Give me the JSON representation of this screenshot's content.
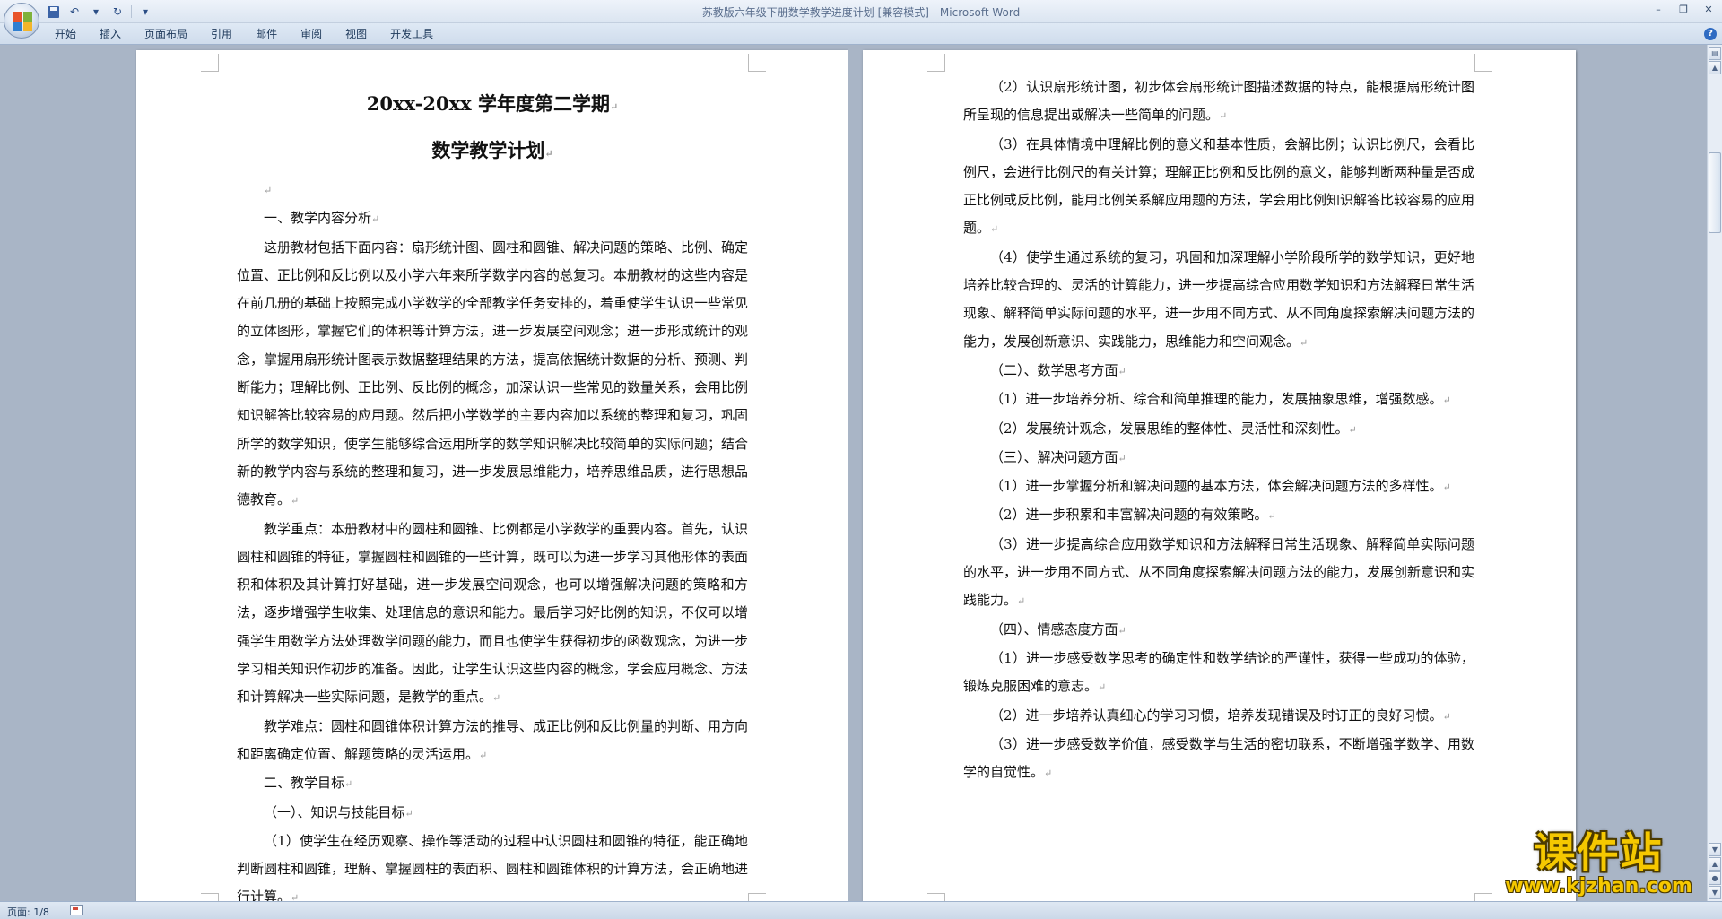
{
  "window": {
    "title": "苏教版六年级下册数学教学进度计划 [兼容模式] - Microsoft Word",
    "controls": [
      "–",
      "❐",
      "✕"
    ]
  },
  "ribbon": {
    "tabs": [
      "开始",
      "插入",
      "页面布局",
      "引用",
      "邮件",
      "审阅",
      "视图",
      "开发工具"
    ]
  },
  "qat": {
    "undo": "↶",
    "redo": "↻",
    "more": "▾"
  },
  "paragraph_mark": "↵",
  "left_page": {
    "title_line1": "20xx-20xx 学年度第二学期",
    "title_line2": "数学教学计划",
    "paragraphs": [
      "一、教学内容分析",
      "这册教材包括下面内容：扇形统计图、圆柱和圆锥、解决问题的策略、比例、确定位置、正比例和反比例以及小学六年来所学数学内容的总复习。本册教材的这些内容是在前几册的基础上按照完成小学数学的全部教学任务安排的，着重使学生认识一些常见的立体图形，掌握它们的体积等计算方法，进一步发展空间观念；进一步形成统计的观念，掌握用扇形统计图表示数据整理结果的方法，提高依据统计数据的分析、预测、判断能力；理解比例、正比例、反比例的概念，加深认识一些常见的数量关系，会用比例知识解答比较容易的应用题。然后把小学数学的主要内容加以系统的整理和复习，巩固所学的数学知识，使学生能够综合运用所学的数学知识解决比较简单的实际问题；结合新的教学内容与系统的整理和复习，进一步发展思维能力，培养思维品质，进行思想品德教育。",
      "教学重点：本册教材中的圆柱和圆锥、比例都是小学数学的重要内容。首先，认识圆柱和圆锥的特征，掌握圆柱和圆锥的一些计算，既可以为进一步学习其他形体的表面积和体积及其计算打好基础，进一步发展空间观念，也可以增强解决问题的策略和方法，逐步增强学生收集、处理信息的意识和能力。最后学习好比例的知识，不仅可以增强学生用数学方法处理数学问题的能力，而且也使学生获得初步的函数观念，为进一步学习相关知识作初步的准备。因此，让学生认识这些内容的概念，学会应用概念、方法和计算解决一些实际问题，是教学的重点。",
      "教学难点：圆柱和圆锥体积计算方法的推导、成正比例和反比例量的判断、用方向和距离确定位置、解题策略的灵活运用。",
      "二、教学目标",
      "（一）、知识与技能目标",
      "（1）使学生在经历观察、操作等活动的过程中认识圆柱和圆锥的特征，能正确地判断圆柱和圆锥，理解、掌握圆柱的表面积、圆柱和圆锥体积的计算方法，会正确地进行计算。"
    ]
  },
  "right_page": {
    "paragraphs": [
      "（2）认识扇形统计图，初步体会扇形统计图描述数据的特点，能根据扇形统计图所呈现的信息提出或解决一些简单的问题。",
      "（3）在具体情境中理解比例的意义和基本性质，会解比例；认识比例尺，会看比例尺，会进行比例尺的有关计算；理解正比例和反比例的意义，能够判断两种量是否成正比例或反比例，能用比例关系解应用题的方法，学会用比例知识解答比较容易的应用题。",
      "（4）使学生通过系统的复习，巩固和加深理解小学阶段所学的数学知识，更好地培养比较合理的、灵活的计算能力，进一步提高综合应用数学知识和方法解释日常生活现象、解释简单实际问题的水平，进一步用不同方式、从不同角度探索解决问题方法的能力，发展创新意识、实践能力，思维能力和空间观念。",
      "（二）、数学思考方面",
      "（1）进一步培养分析、综合和简单推理的能力，发展抽象思维，增强数感。",
      "（2）发展统计观念，发展思维的整体性、灵活性和深刻性。",
      "（三）、解决问题方面",
      "（1）进一步掌握分析和解决问题的基本方法，体会解决问题方法的多样性。",
      "（2）进一步积累和丰富解决问题的有效策略。",
      "（3）进一步提高综合应用数学知识和方法解释日常生活现象、解释简单实际问题的水平，进一步用不同方式、从不同角度探索解决问题方法的能力，发展创新意识和实践能力。",
      "（四）、情感态度方面",
      "（1）进一步感受数学思考的确定性和数学结论的严谨性，获得一些成功的体验，锻炼克服困难的意志。",
      "（2）进一步培养认真细心的学习习惯，培养发现错误及时订正的良好习惯。",
      "（3）进一步感受数学价值，感受数学与生活的密切联系，不断增强学数学、用数学的自觉性。"
    ]
  },
  "status": {
    "page": "页面: 1/8"
  },
  "watermark": {
    "main": "课件站",
    "sub": "www.kjzhan.com"
  }
}
